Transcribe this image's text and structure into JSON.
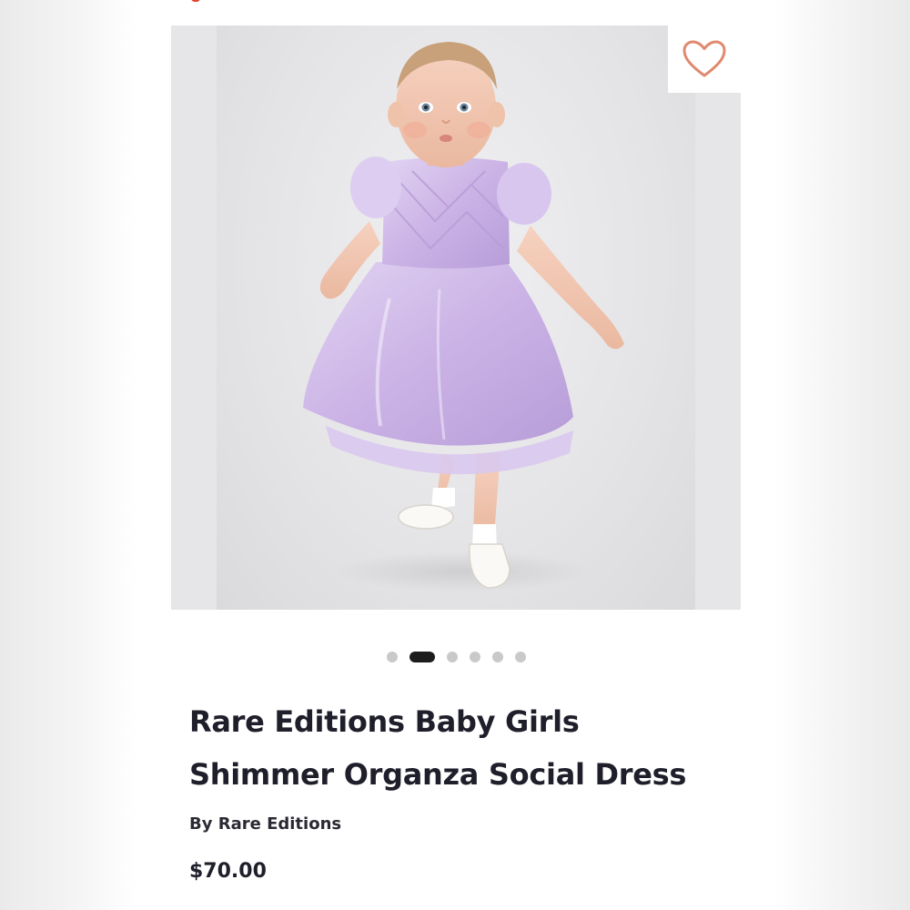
{
  "product": {
    "title": "Rare Editions Baby Girls Shimmer Organza Social Dress",
    "brand": "By Rare Editions",
    "price": "$70.00"
  },
  "gallery": {
    "total_images": 6,
    "active_index": 1
  },
  "icons": {
    "favorite": "heart-outline-icon"
  },
  "colors": {
    "heart": "#e0896f",
    "dress": "#cdb6e6",
    "active_dot": "#1c1c1c",
    "inactive_dot": "#c9c9c9",
    "accent": "#e8402f"
  }
}
